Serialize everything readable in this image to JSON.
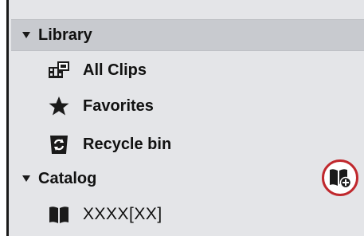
{
  "library": {
    "header_label": "Library",
    "items": [
      {
        "label": "All Clips",
        "icon": "clips-icon"
      },
      {
        "label": "Favorites",
        "icon": "star-icon"
      },
      {
        "label": "Recycle bin",
        "icon": "recycle-bin-icon"
      }
    ]
  },
  "catalog": {
    "header_label": "Catalog",
    "add_button_icon": "add-catalog-icon",
    "items": [
      {
        "label": "XXXX[XX]",
        "icon": "catalog-book-icon"
      }
    ]
  },
  "colors": {
    "panel_bg": "#e4e5e8",
    "header_bg": "#c8cacf",
    "highlight_ring": "#c0282d"
  }
}
